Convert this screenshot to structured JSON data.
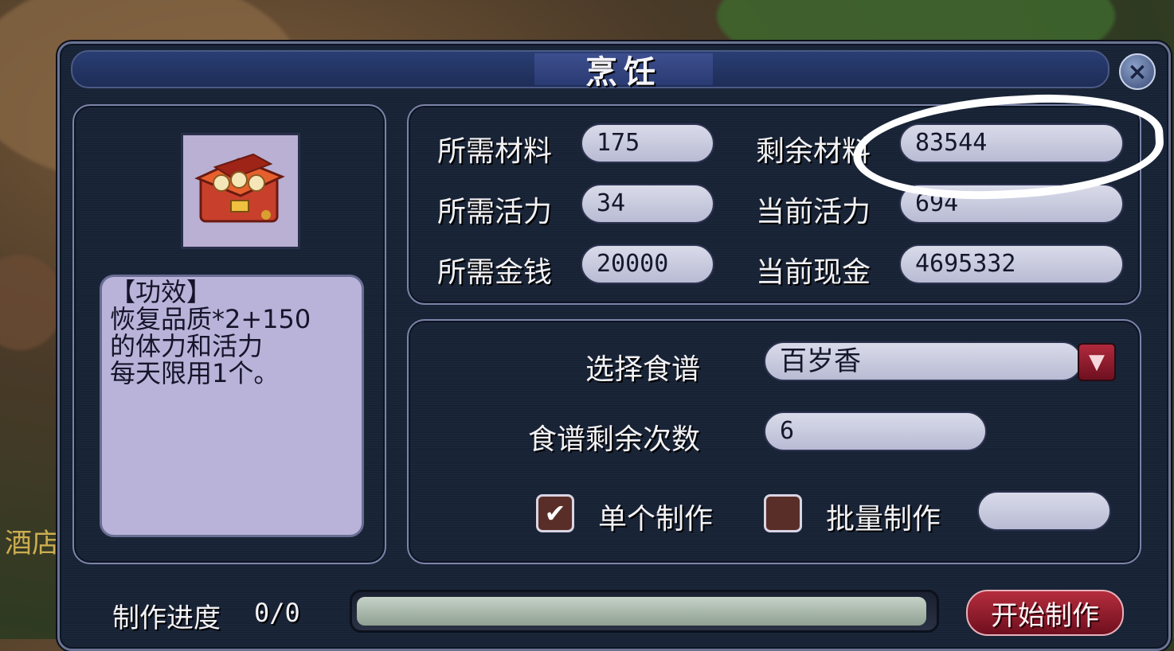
{
  "background_text": "酒店",
  "window": {
    "title": "烹饪",
    "close_icon": "×"
  },
  "item": {
    "icon": "treasure-chest-food-icon",
    "description_lines": [
      "【功效】",
      "恢复品质*2+150",
      "的体力和活力",
      "每天限用1个。"
    ]
  },
  "stats": {
    "required_material_label": "所需材料",
    "required_material_value": "175",
    "remaining_material_label": "剩余材料",
    "remaining_material_value": "83544",
    "required_energy_label": "所需活力",
    "required_energy_value": "34",
    "current_energy_label": "当前活力",
    "current_energy_value": "694",
    "required_money_label": "所需金钱",
    "required_money_value": "20000",
    "current_cash_label": "当前现金",
    "current_cash_value": "4695332"
  },
  "recipe": {
    "select_label": "选择食谱",
    "selected_recipe": "百岁香",
    "remaining_times_label": "食谱剩余次数",
    "remaining_times_value": "6",
    "single_make_label": "单个制作",
    "single_make_checked": true,
    "batch_make_label": "批量制作",
    "batch_make_checked": false,
    "batch_quantity_value": ""
  },
  "progress": {
    "label": "制作进度",
    "value": "0/0",
    "fraction": 0.99
  },
  "start_button_label": "开始制作",
  "colors": {
    "panel_bg": "#172235",
    "accent_red": "#b52d3d",
    "field_bg": "#d9dbea"
  }
}
